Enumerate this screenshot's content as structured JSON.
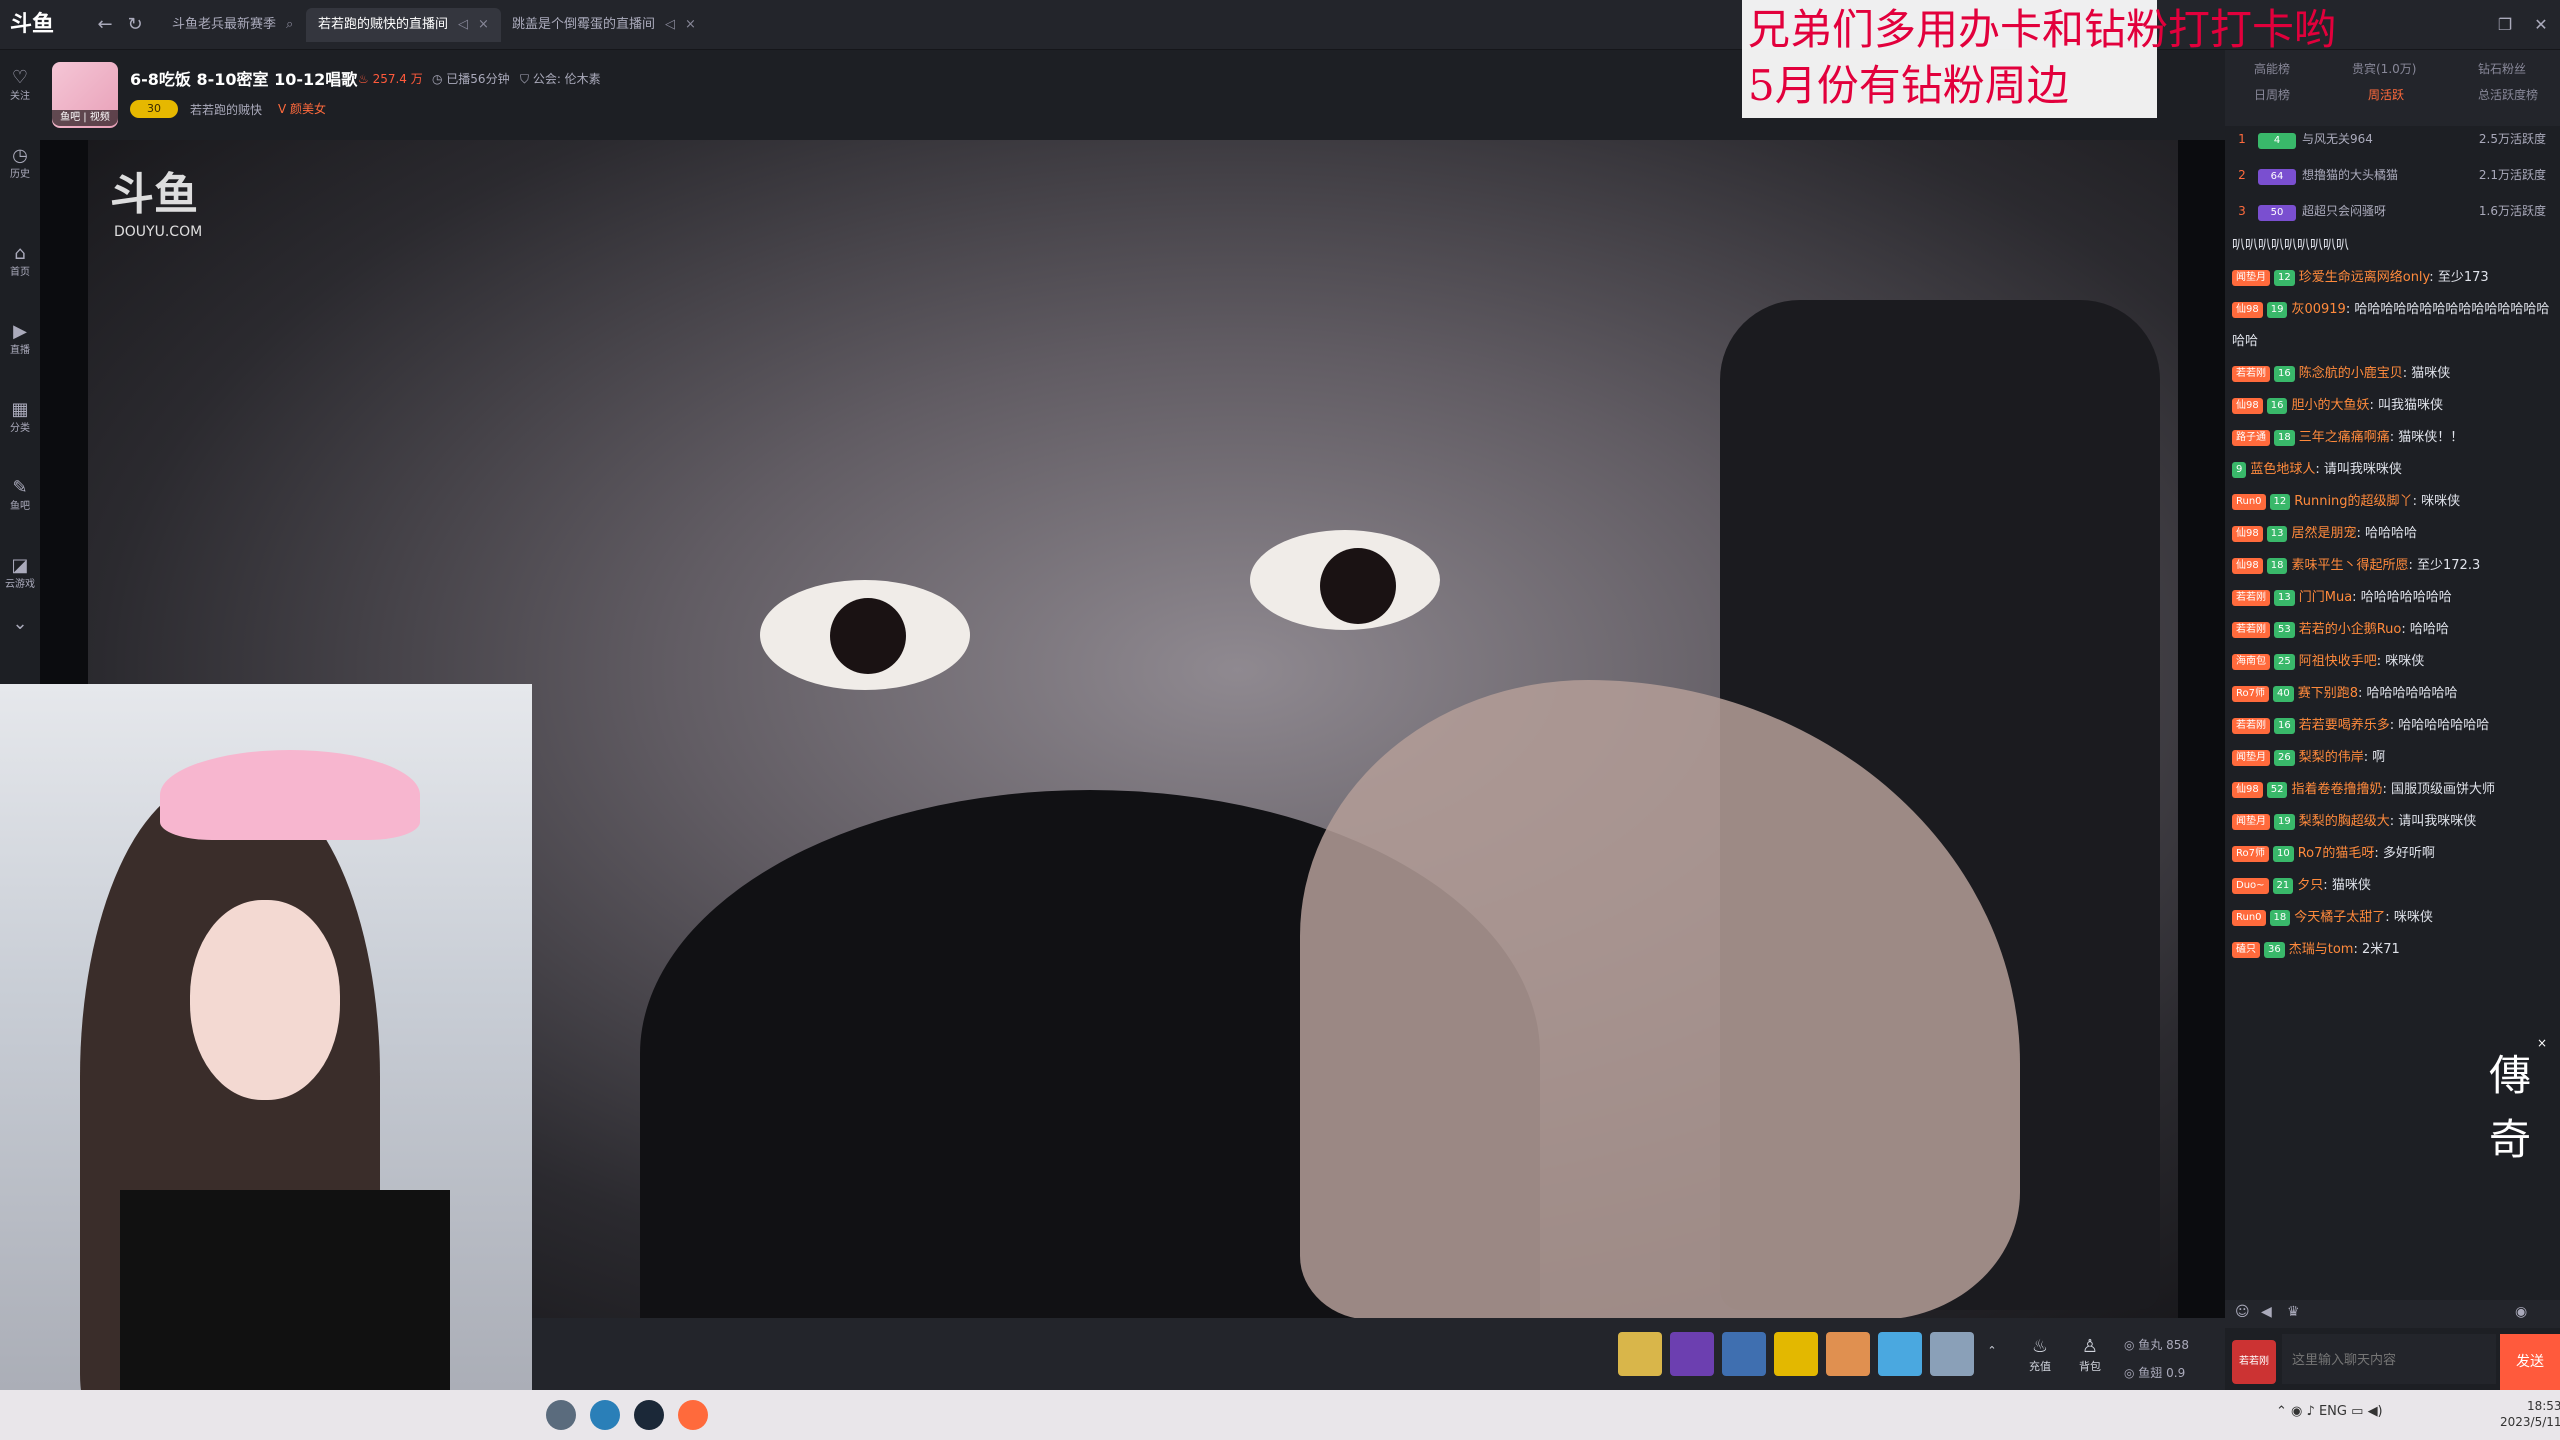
{
  "titlebar": {
    "logo": "斗鱼",
    "tabs": [
      {
        "label": "斗鱼老兵最新赛季",
        "active": false
      },
      {
        "label": "若若跑的贼快的直播间",
        "active": true
      },
      {
        "label": "跳盖是个倒霉蛋的直播间",
        "active": false
      }
    ],
    "close": "×"
  },
  "sidebar": {
    "items": [
      {
        "label": "关注",
        "icon": "♡"
      },
      {
        "label": "历史",
        "icon": "◷"
      },
      {
        "label": "首页",
        "icon": "⌂"
      },
      {
        "label": "直播",
        "icon": "▶"
      },
      {
        "label": "分类",
        "icon": "▦"
      },
      {
        "label": "鱼吧",
        "icon": "✎"
      },
      {
        "label": "云游戏",
        "icon": "◪"
      }
    ],
    "more": "⌄"
  },
  "room": {
    "title": "6-8吃饭 8-10密室 10-12唱歌",
    "hot": "257.4 万",
    "duration": "已播56分钟",
    "guild": "公会: 伦木素",
    "avatar_tag": "鱼吧 | 视频",
    "level": "30",
    "anchor": "若若跑的贼快",
    "tag": "颜美女"
  },
  "video": {
    "watermark": "斗鱼",
    "watermark_sub": "DOUYU.COM"
  },
  "banner": {
    "line1": "兄弟们多用办卡和钻粉打打卡哟",
    "line2": "5月份有钻粉周边"
  },
  "rank": {
    "tabs": [
      "高能榜",
      "贵宾(1.0万)",
      "钻石粉丝",
      "日周榜",
      "周活跃",
      "总活跃度榜"
    ],
    "rows": [
      {
        "num": "1",
        "badge": "4",
        "name": "与风无关964",
        "score": "2.5万活跃度"
      },
      {
        "num": "2",
        "badge": "64",
        "name": "想撸猫的大头橘猫",
        "score": "2.1万活跃度"
      },
      {
        "num": "3",
        "badge": "50",
        "name": "超超只会闷骚呀",
        "score": "1.6万活跃度"
      }
    ]
  },
  "chat": {
    "messages": [
      {
        "fan": "",
        "lvl": "",
        "user": "",
        "text": "叭叭叭叭叭叭叭叭叭"
      },
      {
        "fan": "闻垫月",
        "lvl": "12",
        "user": "珍爱生命远离网络only",
        "text": "至少173"
      },
      {
        "fan": "仙98",
        "lvl": "19",
        "user": "灰00919",
        "text": "哈哈哈哈哈哈哈哈哈哈哈哈哈哈哈哈哈"
      },
      {
        "fan": "若若刚",
        "lvl": "16",
        "user": "陈念航的小鹿宝贝",
        "text": "猫咪侠"
      },
      {
        "fan": "仙98",
        "lvl": "16",
        "user": "胆小的大鱼妖",
        "text": "叫我猫咪侠"
      },
      {
        "fan": "路子通",
        "lvl": "18",
        "user": "三年之痛痛啊痛",
        "text": "猫咪侠！！"
      },
      {
        "fan": "",
        "lvl": "9",
        "user": "蓝色地球人",
        "text": "请叫我咪咪侠"
      },
      {
        "fan": "Run0",
        "lvl": "12",
        "user": "Running的超级脚丫",
        "text": "咪咪侠"
      },
      {
        "fan": "仙98",
        "lvl": "13",
        "user": "居然是朋宠",
        "text": "哈哈哈哈"
      },
      {
        "fan": "仙98",
        "lvl": "18",
        "user": "素味平生丶得起所愿",
        "text": "至少172.3"
      },
      {
        "fan": "若若刚",
        "lvl": "13",
        "user": "门门Mua",
        "text": "哈哈哈哈哈哈哈"
      },
      {
        "fan": "若若刚",
        "lvl": "53",
        "user": "若若的小企鹅Ruo",
        "text": "哈哈哈"
      },
      {
        "fan": "海南包",
        "lvl": "25",
        "user": "阿祖快收手吧",
        "text": "咪咪侠"
      },
      {
        "fan": "Ro7师",
        "lvl": "40",
        "user": "赛下别跑8",
        "text": "哈哈哈哈哈哈哈"
      },
      {
        "fan": "若若刚",
        "lvl": "16",
        "user": "若若要喝养乐多",
        "text": "哈哈哈哈哈哈哈"
      },
      {
        "fan": "闻垫月",
        "lvl": "26",
        "user": "梨梨的伟岸",
        "text": "啊"
      },
      {
        "fan": "仙98",
        "lvl": "52",
        "user": "指着卷卷撸撸奶",
        "text": "国服顶级画饼大师"
      },
      {
        "fan": "闻垫月",
        "lvl": "19",
        "user": "梨梨的胸超级大",
        "text": "请叫我咪咪侠"
      },
      {
        "fan": "Ro7师",
        "lvl": "10",
        "user": "Ro7的猫毛呀",
        "text": "多好听啊"
      },
      {
        "fan": "Duo~",
        "lvl": "21",
        "user": "夕只",
        "text": "猫咪侠"
      },
      {
        "fan": "Run0",
        "lvl": "18",
        "user": "今天橘子太甜了",
        "text": "咪咪侠"
      },
      {
        "fan": "磕只",
        "lvl": "36",
        "user": "杰瑞与tom",
        "text": "2米71"
      }
    ],
    "input_placeholder": "这里输入聊天内容",
    "send": "发送",
    "me": "若若刚"
  },
  "toolbar": {
    "recharge": "充值",
    "backpack": "背包",
    "fish_ball_label": "鱼丸",
    "fish_ball": "858",
    "fish_wing_label": "鱼翅",
    "fish_wing": "0.9"
  },
  "ad": {
    "label": "傳奇",
    "close": "×"
  },
  "taskbar": {
    "tray_lang": "ENG",
    "time": "18:53",
    "date": "2023/5/11"
  }
}
